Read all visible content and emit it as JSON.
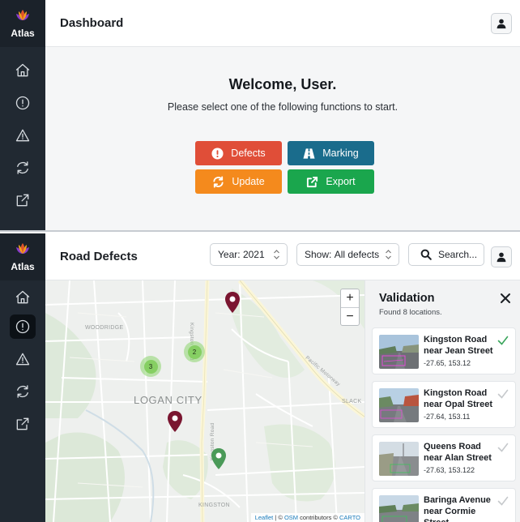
{
  "brand": {
    "name": "Atlas"
  },
  "colors": {
    "sidebar": "#212932",
    "defects": "#e04e38",
    "marking": "#1a6c8c",
    "update": "#f48a1d",
    "export": "#1aa64d",
    "pin_dark": "#7a1630",
    "pin_green": "#4a9a58",
    "cluster": "#86cf63",
    "check_active": "#3aa55c",
    "check_inactive": "#c6c9cc"
  },
  "dashboard": {
    "title": "Dashboard",
    "welcome": "Welcome, User.",
    "subtitle": "Please select one of the following functions to start.",
    "buttons": {
      "defects": {
        "label": "Defects",
        "icon": "exclamation-circle-icon"
      },
      "marking": {
        "label": "Marking",
        "icon": "road-icon"
      },
      "update": {
        "label": "Update",
        "icon": "sync-icon"
      },
      "export": {
        "label": "Export",
        "icon": "external-link-icon"
      }
    }
  },
  "sidebar_icons": [
    "home-icon",
    "alert-circle-icon",
    "alert-triangle-icon",
    "refresh-icon",
    "external-link-icon"
  ],
  "road_defects": {
    "title": "Road Defects",
    "year_select": {
      "label": "Year:",
      "value": "2021"
    },
    "show_select": {
      "label": "Show:",
      "value": "All defects"
    },
    "search": {
      "label": "Search..."
    },
    "map": {
      "labels": {
        "woodridge": "WOODRIDGE",
        "kingston_road_top": "Kingston Road",
        "kingston_road_bottom": "Kingston Road",
        "pacific_motorway": "Pacific Motorway",
        "logan_city": "LOGAN CITY",
        "slacks": "SLACK",
        "kingston": "KINGSTON"
      },
      "zoom_in": "+",
      "zoom_out": "−",
      "clusters": [
        {
          "count": "2"
        },
        {
          "count": "3"
        }
      ],
      "attribution": {
        "leaflet": "Leaflet",
        "sep1": " | © ",
        "osm": "OSM",
        "mid": " contributors © ",
        "carto": "CARTO"
      }
    },
    "validation": {
      "title": "Validation",
      "subtitle": "Found 8 locations.",
      "items": [
        {
          "title": "Kingston Road near Jean Street",
          "coords": "-27.65, 153.12",
          "validated": true
        },
        {
          "title": "Kingston Road near Opal Street",
          "coords": "-27.64, 153.11",
          "validated": false
        },
        {
          "title": "Queens Road near Alan Street",
          "coords": "-27.63, 153.122",
          "validated": false
        },
        {
          "title": "Baringa Avenue near Cormie Street",
          "coords": "",
          "validated": false
        }
      ]
    }
  }
}
